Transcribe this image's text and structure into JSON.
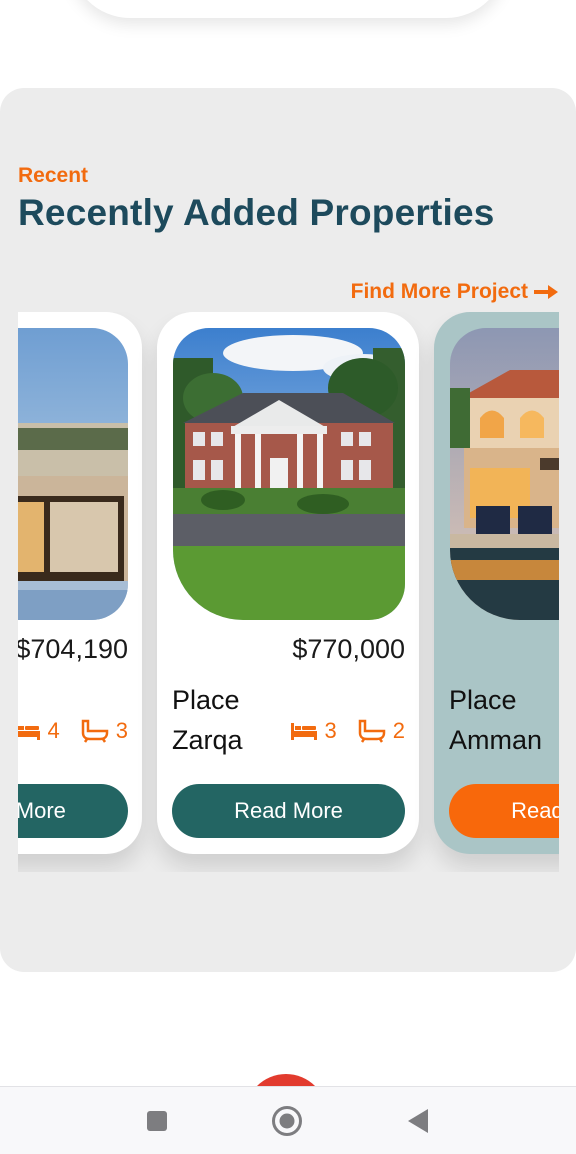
{
  "section": {
    "eyebrow": "Recent",
    "title": "Recently Added Properties",
    "find_more_label": "Find More Project"
  },
  "cards": [
    {
      "price": "$704,190",
      "place": "",
      "beds": "4",
      "baths": "3",
      "button": "Read More",
      "button_color": "#236563"
    },
    {
      "price": "$770,000",
      "place": "Place Zarqa",
      "beds": "3",
      "baths": "2",
      "button": "Read More",
      "button_color": "#236563"
    },
    {
      "price": "",
      "place": "Place Amman",
      "beds": "",
      "baths": "",
      "button": "Read More",
      "button_color": "#f8680b"
    }
  ],
  "colors": {
    "accent": "#f26b0f",
    "heading": "#1d4a5c",
    "teal": "#236563",
    "panel": "#ececec"
  },
  "icons": {
    "arrow": "arrow-right-icon",
    "bed": "bed-icon",
    "bath": "bathtub-icon"
  },
  "navbar": {
    "items": [
      "recent-apps",
      "home",
      "back"
    ]
  }
}
